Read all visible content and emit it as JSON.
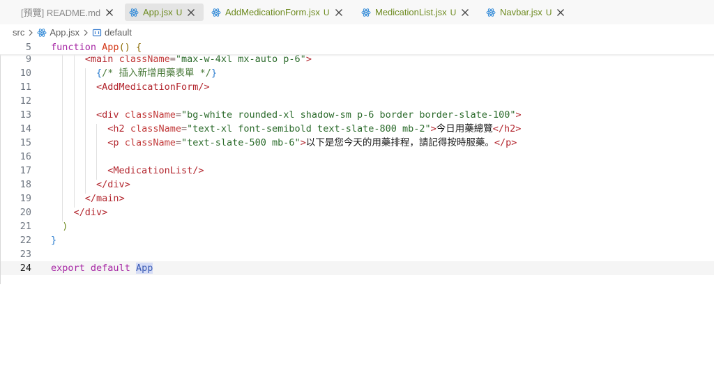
{
  "tabs": [
    {
      "label": "[預覽] README.md",
      "status": "",
      "icon": "preview-icon",
      "active": false
    },
    {
      "label": "App.jsx",
      "status": "U",
      "icon": "react-icon",
      "active": true
    },
    {
      "label": "AddMedicationForm.jsx",
      "status": "U",
      "icon": "react-icon",
      "active": false
    },
    {
      "label": "MedicationList.jsx",
      "status": "U",
      "icon": "react-icon",
      "active": false
    },
    {
      "label": "Navbar.jsx",
      "status": "U",
      "icon": "react-icon",
      "active": false
    }
  ],
  "breadcrumb": {
    "folder": "src",
    "file": "App.jsx",
    "symbol": "default",
    "file_icon": "react-icon",
    "symbol_icon": "symbol-variable-icon"
  },
  "code": {
    "sticky": {
      "num": "5",
      "kw": "function",
      "fn": "App",
      "paren": "()",
      "brace": "{"
    },
    "lines": [
      {
        "num": "9",
        "indent": "      ",
        "t1": "<",
        "tag": "main",
        "attr": "className",
        "str": "\"max-w-4xl mx-auto p-6\"",
        "t2": ">"
      },
      {
        "num": "10",
        "indent": "        ",
        "ob": "{",
        "comment": "/* 插入新增用藥表單 */",
        "cb": "}"
      },
      {
        "num": "11",
        "indent": "        ",
        "t1": "<",
        "tag": "AddMedicationForm",
        "t2": "/>"
      },
      {
        "num": "12"
      },
      {
        "num": "13",
        "indent": "        ",
        "t1": "<",
        "tag": "div",
        "attr": "className",
        "str": "\"bg-white rounded-xl shadow-sm p-6 border border-slate-100\"",
        "t2": ">"
      },
      {
        "num": "14",
        "indent": "          ",
        "t1": "<",
        "tag": "h2",
        "attr": "className",
        "str": "\"text-xl font-semibold text-slate-800 mb-2\"",
        "t2": ">",
        "text": "今日用藥總覽",
        "t3": "</",
        "tag2": "h2",
        "t4": ">"
      },
      {
        "num": "15",
        "indent": "          ",
        "t1": "<",
        "tag": "p",
        "attr": "className",
        "str": "\"text-slate-500 mb-6\"",
        "t2": ">",
        "text": "以下是您今天的用藥排程，請記得按時服藥。",
        "t3": "</",
        "tag2": "p",
        "t4": ">"
      },
      {
        "num": "16"
      },
      {
        "num": "17",
        "indent": "          ",
        "t1": "<",
        "tag": "MedicationList",
        "t2": "/>"
      },
      {
        "num": "18",
        "indent": "        ",
        "t1": "</",
        "tag": "div",
        "t2": ">"
      },
      {
        "num": "19",
        "indent": "      ",
        "t1": "</",
        "tag": "main",
        "t2": ">"
      },
      {
        "num": "20",
        "indent": "    ",
        "t1": "</",
        "tag": "div",
        "t2": ">"
      },
      {
        "num": "21",
        "indent": "  ",
        "p": ")"
      },
      {
        "num": "22",
        "p": "}"
      },
      {
        "num": "23"
      },
      {
        "num": "24",
        "k1": "export",
        "k2": "default",
        "ident": "App"
      }
    ]
  }
}
